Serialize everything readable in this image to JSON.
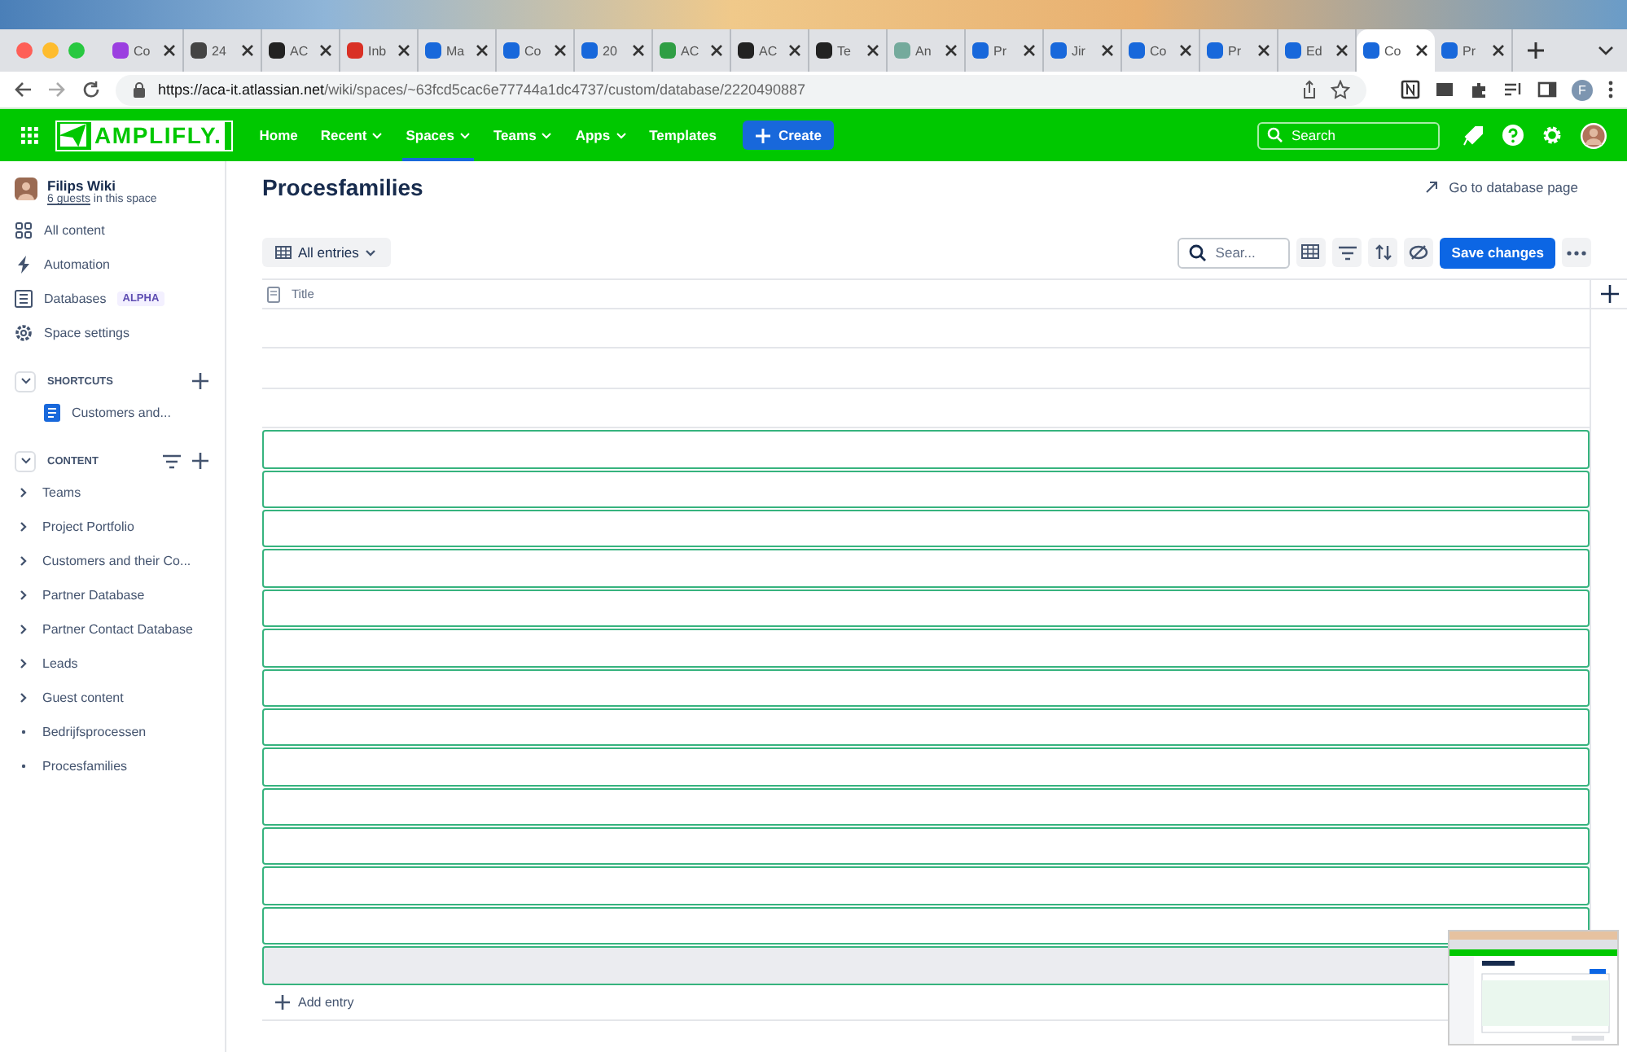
{
  "browser": {
    "tabs": [
      {
        "label": "Co",
        "color": "#9b3fe0",
        "selected": false
      },
      {
        "label": "24",
        "color": "#444444",
        "selected": false
      },
      {
        "label": "AC",
        "color": "#222222",
        "selected": false
      },
      {
        "label": "Inb",
        "color": "#d93025",
        "selected": false
      },
      {
        "label": "Ma",
        "color": "#1868db",
        "selected": false
      },
      {
        "label": "Co",
        "color": "#1868db",
        "selected": false
      },
      {
        "label": "20",
        "color": "#1868db",
        "selected": false
      },
      {
        "label": "AC",
        "color": "#2f9e44",
        "selected": false
      },
      {
        "label": "AC",
        "color": "#222222",
        "selected": false
      },
      {
        "label": "Te",
        "color": "#222222",
        "selected": false
      },
      {
        "label": "An",
        "color": "#74aa9c",
        "selected": false
      },
      {
        "label": "Pr",
        "color": "#1868db",
        "selected": false
      },
      {
        "label": "Jir",
        "color": "#1868db",
        "selected": false
      },
      {
        "label": "Co",
        "color": "#1868db",
        "selected": false
      },
      {
        "label": "Pr",
        "color": "#1868db",
        "selected": false
      },
      {
        "label": "Ed",
        "color": "#1868db",
        "selected": false
      },
      {
        "label": "Co",
        "color": "#1868db",
        "selected": true
      },
      {
        "label": "Pr",
        "color": "#1868db",
        "selected": false
      }
    ],
    "url_host": "https://aca-it.atlassian.net",
    "url_path": "/wiki/spaces/~63fcd5cac6e77744a1dc4737/custom/database/2220490887",
    "profile_initial": "F"
  },
  "topnav": {
    "logo": "AMPLIFLY.",
    "items": [
      {
        "label": "Home",
        "dropdown": false,
        "selected": false
      },
      {
        "label": "Recent",
        "dropdown": true,
        "selected": false
      },
      {
        "label": "Spaces",
        "dropdown": true,
        "selected": true
      },
      {
        "label": "Teams",
        "dropdown": true,
        "selected": false
      },
      {
        "label": "Apps",
        "dropdown": true,
        "selected": false
      },
      {
        "label": "Templates",
        "dropdown": false,
        "selected": false
      }
    ],
    "create": "Create",
    "search_placeholder": "Search"
  },
  "sidebar": {
    "space_name": "Filips Wiki",
    "guests_link": "6 guests",
    "guests_suffix": " in this space",
    "nav": [
      {
        "label": "All content"
      },
      {
        "label": "Automation"
      },
      {
        "label": "Databases",
        "badge": "ALPHA"
      },
      {
        "label": "Space settings"
      }
    ],
    "shortcuts_heading": "SHORTCUTS",
    "shortcuts": [
      {
        "label": "Customers and..."
      }
    ],
    "content_heading": "CONTENT",
    "content": [
      {
        "label": "Teams",
        "has_children": true
      },
      {
        "label": "Project Portfolio",
        "has_children": true
      },
      {
        "label": "Customers and their Co...",
        "has_children": true
      },
      {
        "label": "Partner Database",
        "has_children": true
      },
      {
        "label": "Partner Contact Database",
        "has_children": true
      },
      {
        "label": "Leads",
        "has_children": true
      },
      {
        "label": "Guest content",
        "has_children": true
      },
      {
        "label": "Bedrijfsprocessen",
        "has_children": false
      },
      {
        "label": "Procesfamilies",
        "has_children": false
      }
    ]
  },
  "page": {
    "title": "Procesfamilies",
    "db_link": "Go to database page",
    "view": "All entries",
    "search_placeholder": "Sear...",
    "save": "Save changes",
    "table": {
      "columns": [
        "Title"
      ],
      "rows": [
        {
          "outlined": false,
          "shaded": false
        },
        {
          "outlined": false,
          "shaded": false
        },
        {
          "outlined": false,
          "shaded": false
        },
        {
          "outlined": true,
          "shaded": false
        },
        {
          "outlined": true,
          "shaded": false
        },
        {
          "outlined": true,
          "shaded": false
        },
        {
          "outlined": true,
          "shaded": false
        },
        {
          "outlined": true,
          "shaded": false
        },
        {
          "outlined": true,
          "shaded": false
        },
        {
          "outlined": true,
          "shaded": false
        },
        {
          "outlined": true,
          "shaded": false
        },
        {
          "outlined": true,
          "shaded": false
        },
        {
          "outlined": true,
          "shaded": false
        },
        {
          "outlined": true,
          "shaded": false
        },
        {
          "outlined": true,
          "shaded": false
        },
        {
          "outlined": true,
          "shaded": false
        },
        {
          "outlined": true,
          "shaded": true
        }
      ]
    },
    "add_entry": "Add entry"
  }
}
